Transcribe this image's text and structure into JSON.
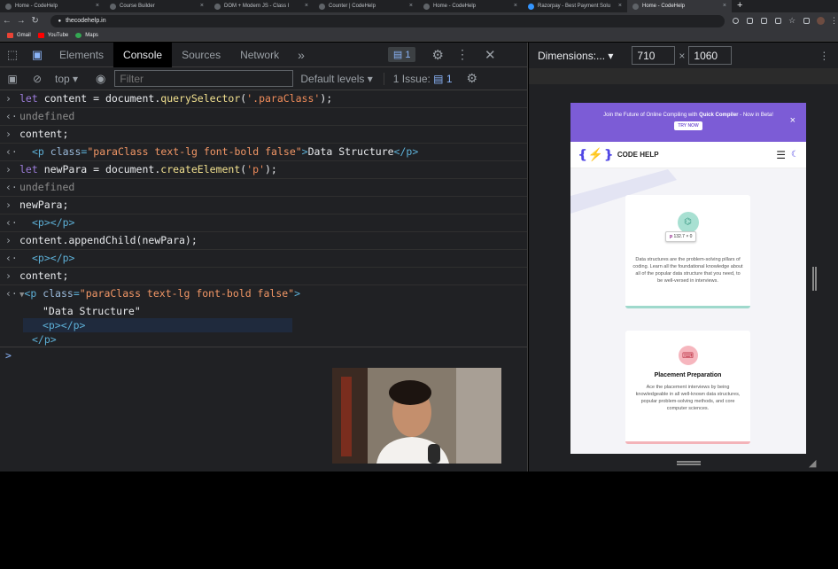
{
  "browser": {
    "tabs": [
      {
        "label": "Home - CodeHelp",
        "active": false
      },
      {
        "label": "Course Builder",
        "active": false
      },
      {
        "label": "DOM + Modern JS - Class I",
        "active": false
      },
      {
        "label": "Counter | CodeHelp",
        "active": false
      },
      {
        "label": "Home - CodeHelp",
        "active": false
      },
      {
        "label": "Razorpay - Best Payment Solu",
        "active": false
      },
      {
        "label": "Home - CodeHelp",
        "active": true
      }
    ],
    "new_tab": "+",
    "url": "thecodehelp.in",
    "bookmarks": [
      "Gmail",
      "YouTube",
      "Maps"
    ]
  },
  "devtools": {
    "tabs": [
      "Elements",
      "Console",
      "Sources",
      "Network"
    ],
    "active_tab": "Console",
    "more": "»",
    "issues_badge": "1",
    "context": "top",
    "filter_placeholder": "Filter",
    "levels": "Default levels",
    "issues_label": "1 Issue:",
    "issues_count": "1"
  },
  "console": {
    "line1": {
      "kw": "let",
      "rest1": " content = document.",
      "fn": "querySelector",
      "p1": "(",
      "str": "'.paraClass'",
      "p2": ");"
    },
    "line2": "undefined",
    "line3": "content;",
    "line4": {
      "open": "<p",
      "attr": " class",
      "eq": "=",
      "val": "\"paraClass text-lg font-bold false\"",
      "gt": ">",
      "text": "Data Structure",
      "close": "</p>"
    },
    "line5": {
      "kw": "let",
      "rest1": " newPara = document.",
      "fn": "createElement",
      "p1": "(",
      "str": "'p'",
      "p2": ");"
    },
    "line6": "undefined",
    "line7": "newPara;",
    "line8": "<p></p>",
    "line9": "content.appendChild(newPara);",
    "line10": "<p></p>",
    "line11": "content;",
    "line12": {
      "tri": "▼",
      "open": "<p",
      "attr": " class",
      "eq": "=",
      "val": "\"paraClass text-lg font-bold false\"",
      "gt": ">"
    },
    "line13": "\"Data Structure\"",
    "line14": "<p></p>",
    "line15": "</p>",
    "prompt": ">"
  },
  "device": {
    "label": "Dimensions:...",
    "width": "710",
    "times": "×",
    "height": "1060"
  },
  "site": {
    "banner_text1": "Join the Future of Online Compiling with ",
    "banner_bold": "Quick Compiler",
    "banner_text2": " - Now in Beta!",
    "try_now": "TRY NOW",
    "close": "×",
    "logo": "CODE HELP",
    "tooltip_tag": "p",
    "tooltip_size": "132.7 × 0",
    "card1_text": "Data structures are the problem-solving pillars of coding. Learn all the foundational knowledge about all of the popular data structure that you need, to be well-versed in interviews.",
    "card2_title": "Placement Preparation",
    "card2_text": "Ace the placement interviews by being knowledgeable in all well-known data structures, popular problem-solving methods, and core computer sciences."
  },
  "colors": {
    "accent": "#8ab4f8",
    "banner": "#7c5cd6",
    "card1_line": "#9fd9cc",
    "card2_line": "#f3b3b9"
  }
}
